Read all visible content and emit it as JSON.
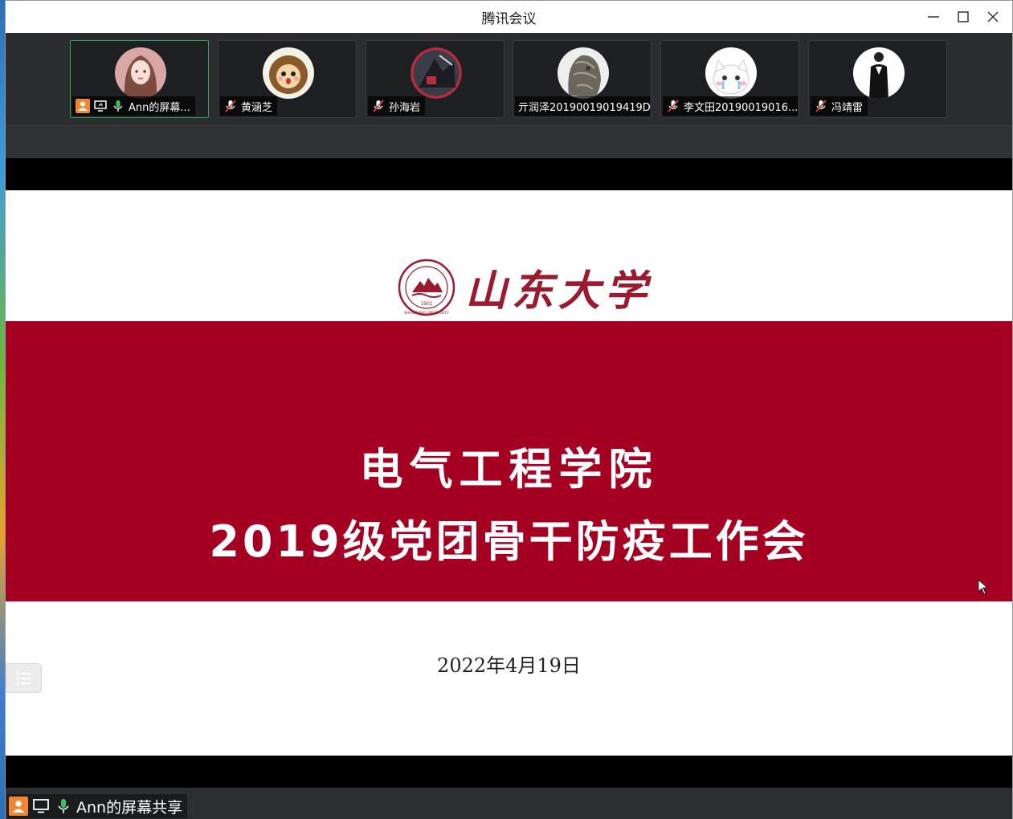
{
  "window": {
    "title": "腾讯会议"
  },
  "participants": [
    {
      "name": "Ann的屏幕...",
      "avatar": "avatar-girl-portrait",
      "mic": "on",
      "sharing": true,
      "host": true,
      "active": true
    },
    {
      "name": "黄涵芝",
      "avatar": "avatar-cartoon-lion",
      "mic": "muted"
    },
    {
      "name": "孙海岩",
      "avatar": "avatar-dark-photo",
      "mic": "muted"
    },
    {
      "name": "亓润泽20190019019419D",
      "avatar": "avatar-stone-statue",
      "mic": "none"
    },
    {
      "name": "李文田20190019016...",
      "avatar": "avatar-cartoon-cat",
      "mic": "muted"
    },
    {
      "name": "冯靖雷",
      "avatar": "avatar-black-figure",
      "mic": "muted"
    }
  ],
  "slide": {
    "logo_text": "山东大学",
    "seal_year": "1901",
    "seal_text": "SHANDONG UNIVERSITY",
    "line1": "电气工程学院",
    "line2": "2019级党团骨干防疫工作会",
    "date": "2022年4月19日",
    "band_color": "#a50022"
  },
  "share_bar": {
    "label": "Ann的屏幕共享"
  }
}
